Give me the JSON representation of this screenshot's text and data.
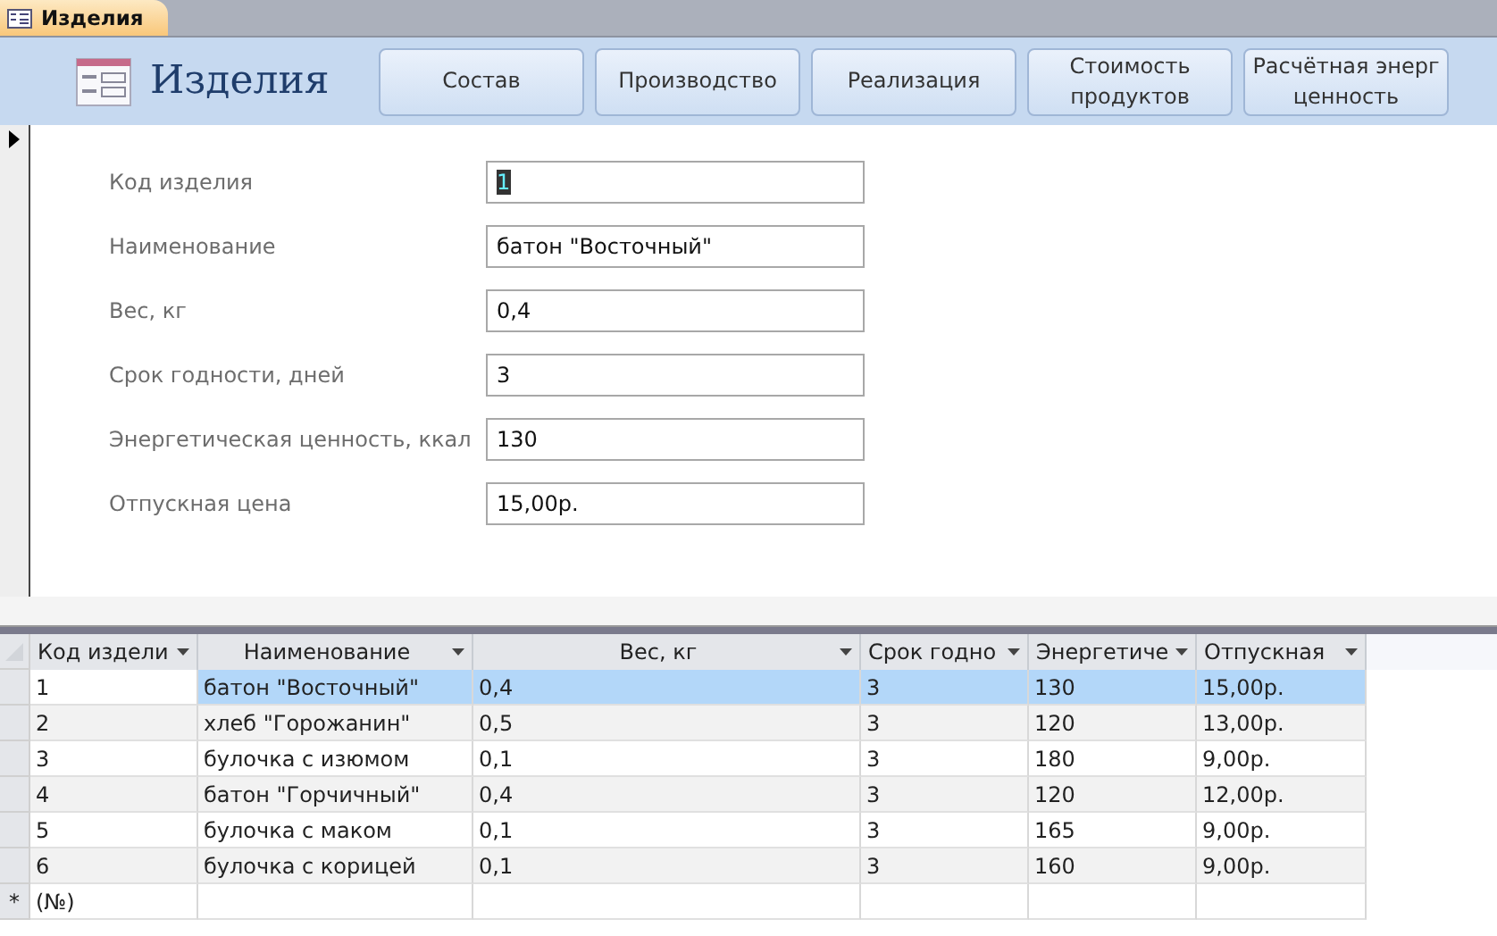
{
  "document_tab": {
    "label": "Изделия",
    "selected": true
  },
  "header": {
    "title": "Изделия",
    "buttons": [
      {
        "lines": [
          "Состав"
        ]
      },
      {
        "lines": [
          "Производство"
        ]
      },
      {
        "lines": [
          "Реализация"
        ]
      },
      {
        "lines": [
          "Стоимость",
          "продуктов"
        ]
      },
      {
        "lines": [
          "Расчётная энерг",
          "ценность"
        ]
      }
    ]
  },
  "form": {
    "fields": [
      {
        "label": "Код изделия",
        "value": "1",
        "text_selected": true
      },
      {
        "label": "Наименование",
        "value": "батон \"Восточный\"",
        "text_selected": false
      },
      {
        "label": "Вес, кг",
        "value": "0,4",
        "text_selected": false
      },
      {
        "label": "Срок годности, дней",
        "value": "3",
        "text_selected": false
      },
      {
        "label": "Энергетическая ценность, ккал",
        "value": "130",
        "text_selected": false
      },
      {
        "label": "Отпускная цена",
        "value": "15,00р.",
        "text_selected": false
      }
    ]
  },
  "table": {
    "columns": [
      {
        "label": "Код издели"
      },
      {
        "label": "Наименование"
      },
      {
        "label": "Вес, кг"
      },
      {
        "label": "Срок годно"
      },
      {
        "label": "Энергетиче"
      },
      {
        "label": "Отпускная"
      }
    ],
    "rows": [
      {
        "selected": true,
        "cells": [
          "1",
          "батон \"Восточный\"",
          "0,4",
          "3",
          "130",
          "15,00р."
        ]
      },
      {
        "selected": false,
        "cells": [
          "2",
          "хлеб \"Горожанин\"",
          "0,5",
          "3",
          "120",
          "13,00р."
        ]
      },
      {
        "selected": false,
        "cells": [
          "3",
          "булочка с изюмом",
          "0,1",
          "3",
          "180",
          "9,00р."
        ]
      },
      {
        "selected": false,
        "cells": [
          "4",
          "батон \"Горчичный\"",
          "0,4",
          "3",
          "120",
          "12,00р."
        ]
      },
      {
        "selected": false,
        "cells": [
          "5",
          "булочка с маком",
          "0,1",
          "3",
          "165",
          "9,00р."
        ]
      },
      {
        "selected": false,
        "cells": [
          "6",
          "булочка с корицей",
          "0,1",
          "3",
          "160",
          "9,00р."
        ]
      }
    ],
    "new_row": {
      "marker": "*",
      "cell": "(№)"
    }
  }
}
